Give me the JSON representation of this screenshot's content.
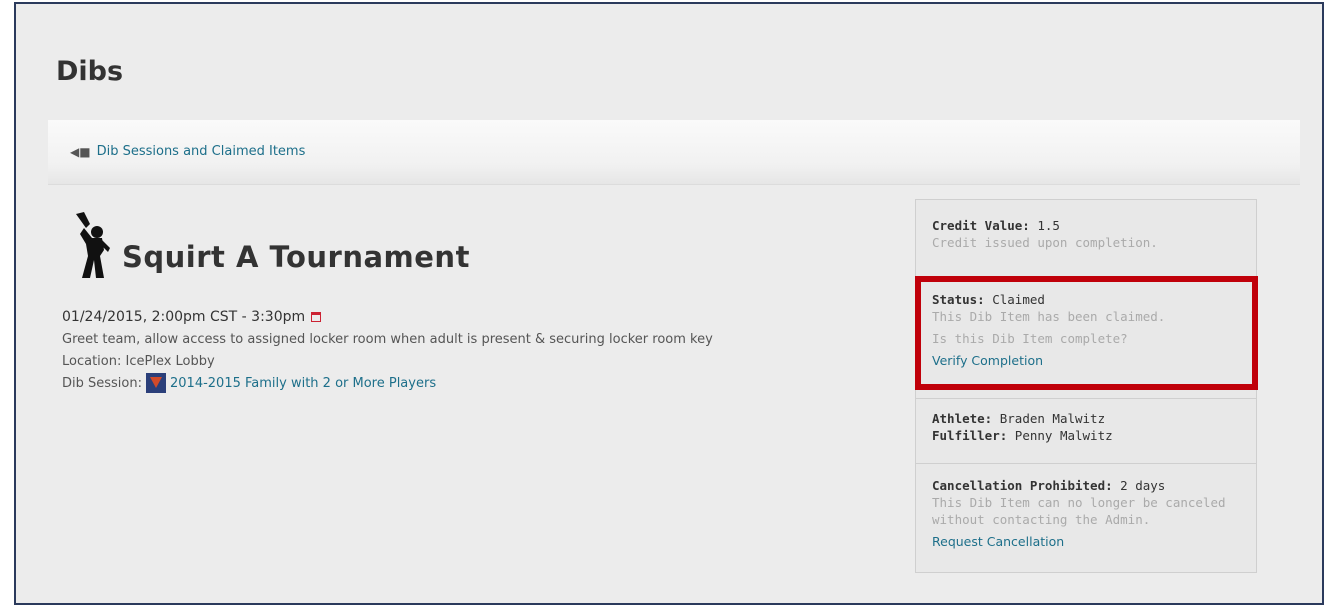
{
  "page": {
    "title": "Dibs"
  },
  "breadcrumb": {
    "label": "Dib Sessions and Claimed Items"
  },
  "item": {
    "title": "Squirt A Tournament",
    "datetime": "01/24/2015, 2:00pm CST - 3:30pm",
    "description": "Greet team, allow access to assigned locker room when adult is present & securing locker room key",
    "location": "Location: IcePlex Lobby",
    "session_label": "Dib Session:",
    "session_name": "2014-2015 Family with 2 or More Players"
  },
  "panel": {
    "credit": {
      "label": "Credit Value:",
      "value": "1.5",
      "note": "Credit issued upon completion."
    },
    "status": {
      "label": "Status:",
      "value": "Claimed",
      "note": "This Dib Item has been claimed.",
      "question": "Is this Dib Item complete?",
      "action": "Verify Completion"
    },
    "people": {
      "athlete_label": "Athlete:",
      "athlete": "Braden Malwitz",
      "fulfiller_label": "Fulfiller:",
      "fulfiller": "Penny Malwitz"
    },
    "cancellation": {
      "label": "Cancellation Prohibited:",
      "value": "2 days",
      "note_line1": "This Dib Item can no longer be canceled",
      "note_line2": "without contacting the Admin.",
      "action": "Request Cancellation"
    }
  },
  "colors": {
    "link": "#1d6f8a",
    "highlight": "#c0000a",
    "panel_bg": "#e8e8e8"
  },
  "icons": [
    "back-arrow-icon",
    "waving-figure-icon",
    "calendar-icon",
    "team-shield-icon"
  ]
}
